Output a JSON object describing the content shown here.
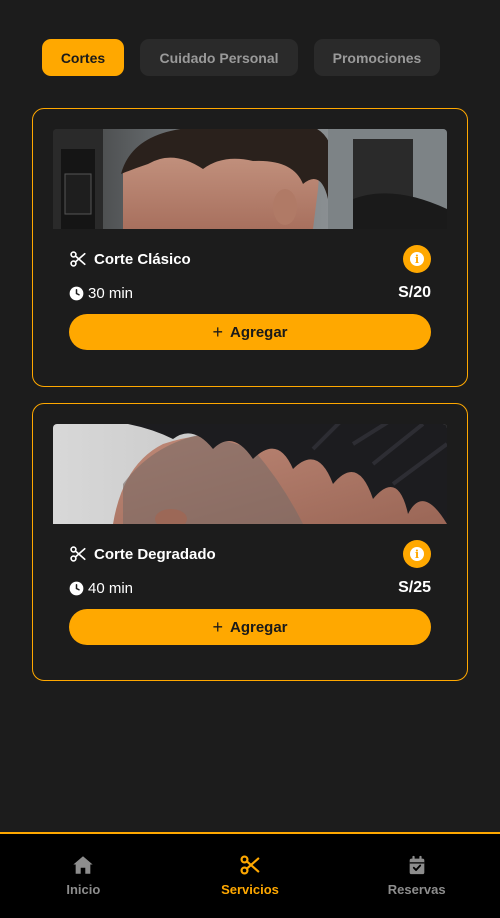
{
  "tabs": [
    {
      "label": "Cortes",
      "active": true
    },
    {
      "label": "Cuidado Personal",
      "active": false
    },
    {
      "label": "Promociones",
      "active": false
    }
  ],
  "services": [
    {
      "name": "Corte Clásico",
      "duration": "30 min",
      "price": "S/20",
      "add_label": "Agregar",
      "icon": "scissors-icon"
    },
    {
      "name": "Corte Degradado",
      "duration": "40 min",
      "price": "S/25",
      "add_label": "Agregar",
      "icon": "scissors-icon"
    }
  ],
  "nav": [
    {
      "label": "Inicio",
      "icon": "home-icon",
      "active": false
    },
    {
      "label": "Servicios",
      "icon": "scissors-icon",
      "active": true
    },
    {
      "label": "Reservas",
      "icon": "calendar-check-icon",
      "active": false
    }
  ],
  "colors": {
    "accent": "#ffa800",
    "background": "#1c1c1c",
    "nav_background": "#000000"
  }
}
